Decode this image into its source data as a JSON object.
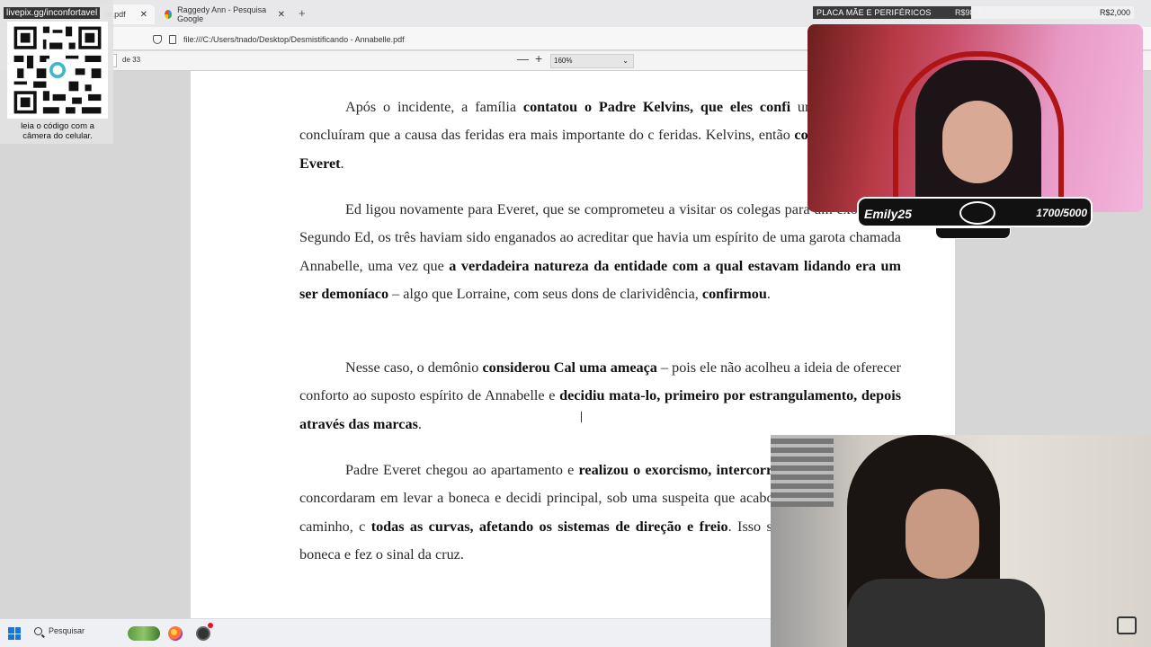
{
  "tabs": [
    {
      "label": "le.pdf",
      "close": "✕"
    },
    {
      "label": "Raggedy Ann - Pesquisa Google",
      "close": "✕"
    }
  ],
  "new_tab": "+",
  "address": "file:///C:/Users/tnado/Desktop/Desmistificando - Annabelle.pdf",
  "pdf_toolbar": {
    "page_of": "de 33",
    "zoom_minus": "—",
    "zoom_plus": "+",
    "zoom": "160%"
  },
  "document": {
    "paragraphs": [
      {
        "parts": [
          {
            "t": "Após o incidente, a família "
          },
          {
            "b": "contatou o Padre Kelvins, que eles confi"
          },
          {
            "t": " um médico, pois concluíram que a causa das feridas era mais importante do c feridas. Kelvins, então "
          },
          {
            "b": "contatou o Padre Everet"
          },
          {
            "t": "."
          }
        ]
      },
      {
        "parts": [
          {
            "t": "Ed ligou novamente para Everet, que se comprometeu a visitar os colegas para um exorcismo. Segundo Ed, os três haviam sido enganados ao acreditar que havia um espírito de uma garota chamada Annabelle, uma vez que "
          },
          {
            "b": "a verdadeira natureza da entidade com a qual estavam lidando era um ser demoníaco"
          },
          {
            "t": " – algo que Lorraine, com seus dons de clarividência, "
          },
          {
            "b": "confirmou"
          },
          {
            "t": "."
          }
        ]
      },
      {
        "parts": [
          {
            "t": "Nesse caso, o demônio "
          },
          {
            "b": "considerou Cal uma ameaça"
          },
          {
            "t": " – pois ele não acolheu a ideia de oferecer conforto ao suposto espírito de Annabelle e "
          },
          {
            "b": "decidiu mata-lo, primeiro por estrangulamento, depois através das marcas"
          },
          {
            "t": "."
          }
        ]
      },
      {
        "parts": [
          {
            "t": "Padre Everet chegou ao apartamento e "
          },
          {
            "b": "realizou o exorcismo, intercorrências"
          },
          {
            "t": ". Ed e Lorraine concordaram em levar a boneca e decidi principal, sob uma suspeita que acabou se confirmando: no caminho, c "
          },
          {
            "b": "todas as curvas, afetando os sistemas de direção e freio"
          },
          {
            "t": ". Isso só paro água benta na boneca e fez o sinal da cruz."
          }
        ]
      }
    ]
  },
  "qr_overlay": {
    "url": "livepix.gg/inconfortavel",
    "caption": "leia o código com a câmera do celular."
  },
  "donation_goal": {
    "title": "PLACA MÃE E PERIFÉRICOS",
    "current": "R$986.61",
    "goal": "R$2,000",
    "progress": 0.4933
  },
  "webcam_badge": {
    "name": "Emily25",
    "number": "1700/5000"
  },
  "taskbar": {
    "search_placeholder": "Pesquisar"
  }
}
